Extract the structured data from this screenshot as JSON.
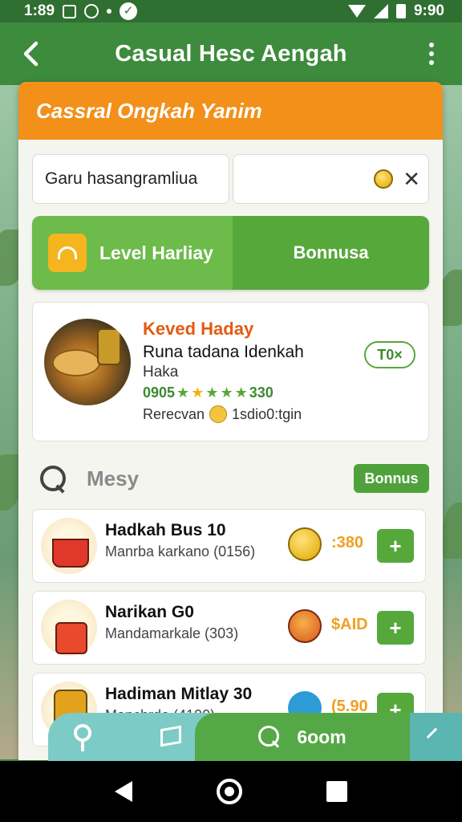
{
  "status_bar": {
    "time_left": "1:89",
    "time_right": "9:90"
  },
  "app_bar": {
    "title": "Casual Hesc Aengah"
  },
  "card": {
    "header": "Cassral Ongkah Yanim"
  },
  "search": {
    "value": "Garu hasangramliua"
  },
  "level": {
    "label": "Level Harliay",
    "bonus_label": "Bonnusa"
  },
  "feature": {
    "title": "Keved Haday",
    "subtitle": "Runa tadana Idenkah",
    "subtitle2": "Haka",
    "rating_prefix": "0905",
    "rating_suffix": "330",
    "review_prefix": "Rerecvan",
    "review_suffix": "1sdio0:tgin",
    "tag": "T0×"
  },
  "section": {
    "title": "Mesy",
    "bonus_label": "Bonnus"
  },
  "items": [
    {
      "title": "Hadkah Bus 10",
      "subtitle": "Manrba karkano (0156)",
      "price": ":380",
      "add_label": "+"
    },
    {
      "title": "Narikan G0",
      "subtitle": "Mandamarkale (303)",
      "price": "$AID",
      "add_label": "+"
    },
    {
      "title": "Hadiman Mitlay 30",
      "subtitle": "Manchrdo (4100)",
      "price": "(5.90",
      "add_label": "+"
    }
  ],
  "bottom_nav": {
    "main_label": "6oom"
  },
  "colors": {
    "primary_green": "#3d8b3d",
    "accent_orange": "#f29019",
    "button_green": "#56a83b"
  }
}
